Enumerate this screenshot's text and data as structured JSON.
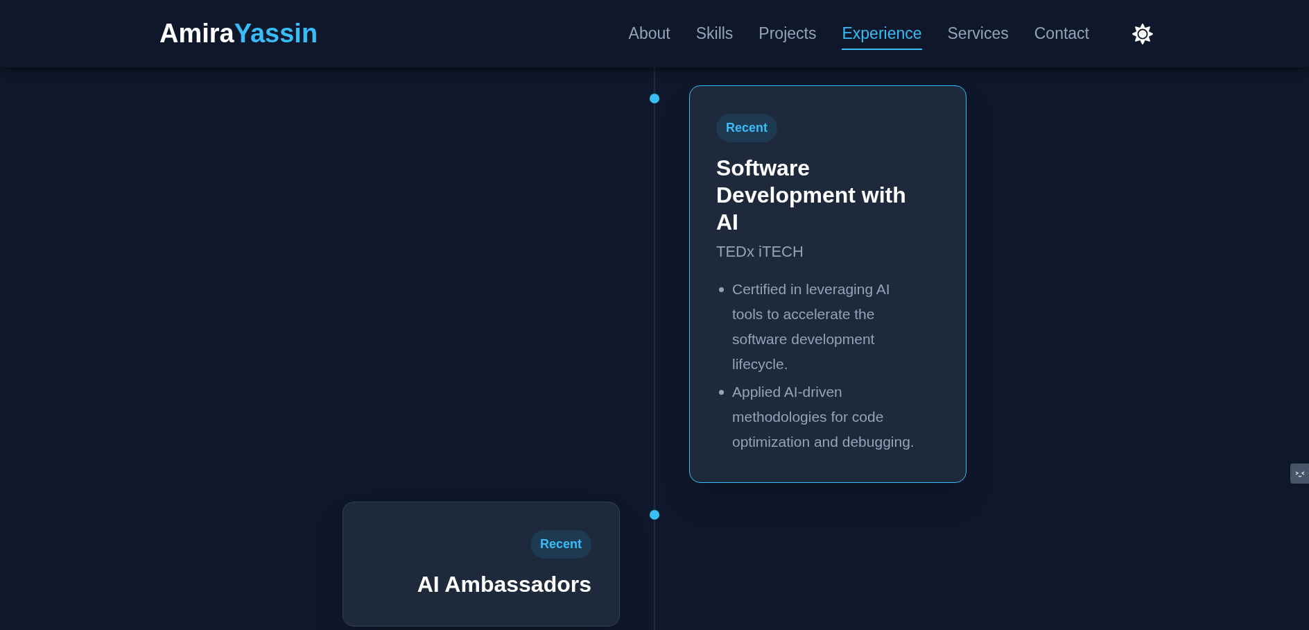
{
  "header": {
    "logo": {
      "first": "Amira",
      "last": "Yassin"
    },
    "nav": [
      {
        "label": "About",
        "selected": false
      },
      {
        "label": "Skills",
        "selected": false
      },
      {
        "label": "Projects",
        "selected": false
      },
      {
        "label": "Experience",
        "selected": true
      },
      {
        "label": "Services",
        "selected": false
      },
      {
        "label": "Contact",
        "selected": false
      }
    ]
  },
  "timeline": [
    {
      "kind": "right",
      "highlighted": true,
      "badge": "Recent",
      "title": "Software Development with AI",
      "organization": "TEDx iTECH",
      "bullets": [
        "Certified in leveraging AI tools to accelerate the software development lifecycle.",
        "Applied AI-driven methodologies for code optimization and debugging."
      ]
    },
    {
      "kind": "left",
      "highlighted": false,
      "badge": "Recent",
      "title": "AI Ambassadors"
    }
  ]
}
